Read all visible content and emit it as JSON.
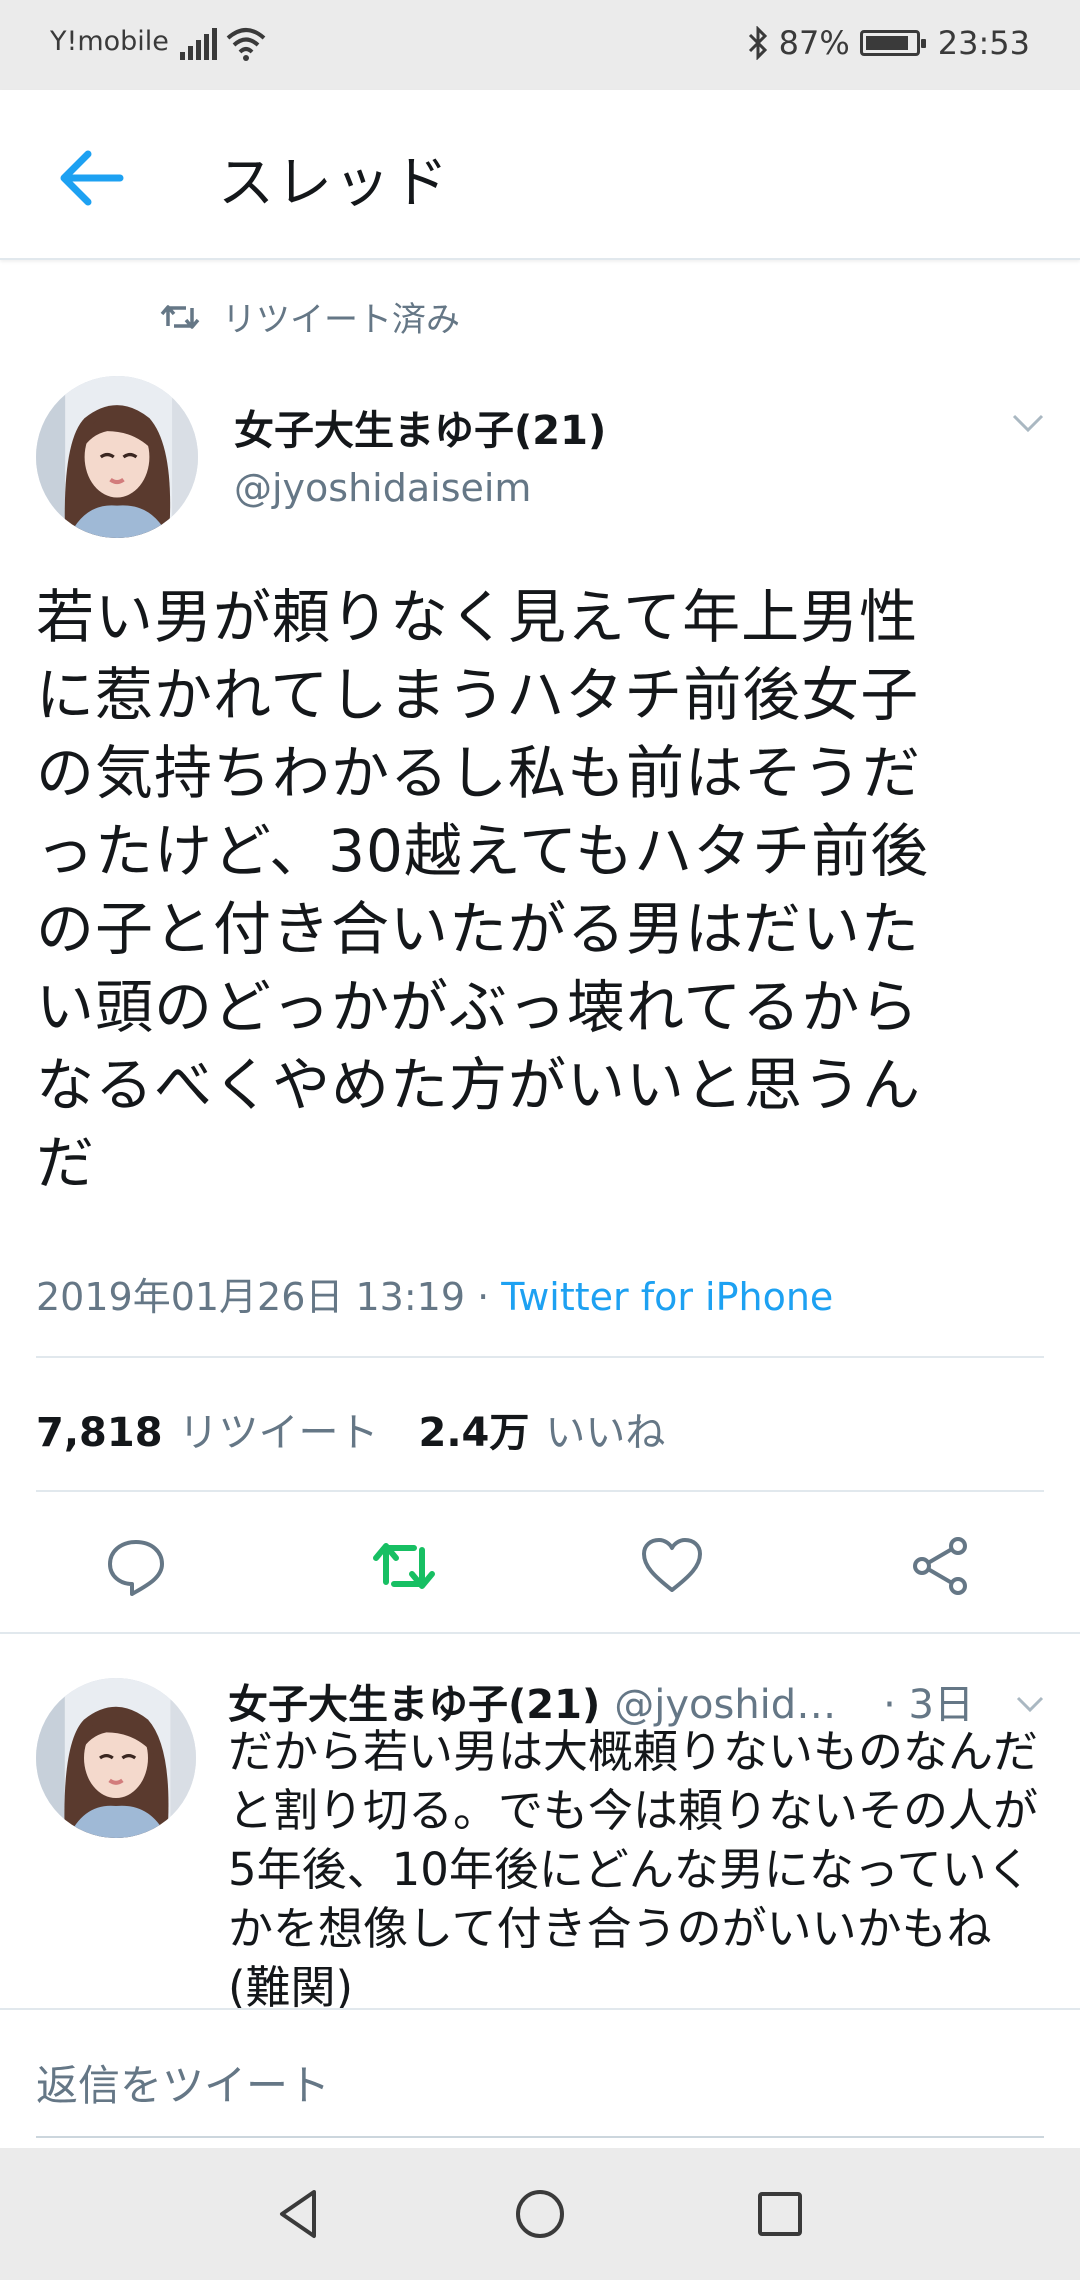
{
  "status_bar": {
    "carrier": "Y!mobile",
    "battery": "87%",
    "battery_level": 0.87,
    "time": "23:53"
  },
  "header": {
    "title": "スレッド"
  },
  "retweet_context": {
    "label": "リツイート済み"
  },
  "tweet": {
    "name": "女子大生まゆ子(21)",
    "handle": "@jyoshidaiseim",
    "lines": [
      "若い男が頼りなく見えて年上男性",
      "に惹かれてしまうハタチ前後女子",
      "の気持ちわかるし私も前はそうだ",
      "ったけど、30越えてもハタチ前後",
      "の子と付き合いたがる男はだいた",
      "い頭のどっかがぶっ壊れてるから",
      "なるべくやめた方がいいと思うん",
      "だ"
    ],
    "timestamp": "2019年01月26日 13:19",
    "separator": " · ",
    "source": "Twitter for iPhone",
    "retweet_count": "7,818",
    "retweet_label": "リツイート",
    "like_count": "2.4万",
    "like_label": "いいね"
  },
  "reply": {
    "name": "女子大生まゆ子(21)",
    "handle": "@jyoshid…",
    "time": "· 3日",
    "lines": [
      "だから若い男は大概頼りないものなんだ",
      "と割り切る。でも今は頼りないその人が",
      "5年後、10年後にどんな男になっていく",
      "かを想像して付き合うのがいいかもね",
      "(難関)"
    ]
  },
  "composer": {
    "placeholder": "返信をツイート"
  },
  "colors": {
    "accent": "#1da1f2",
    "retweet_green": "#17bf63",
    "secondary_text": "#657786",
    "icon_gray": "#657786"
  },
  "icons": {
    "back": "arrow-left-icon",
    "retweet_context": "retweet-icon",
    "reply": "reply-icon",
    "retweet": "retweet-icon",
    "like": "heart-icon",
    "share": "share-icon"
  }
}
